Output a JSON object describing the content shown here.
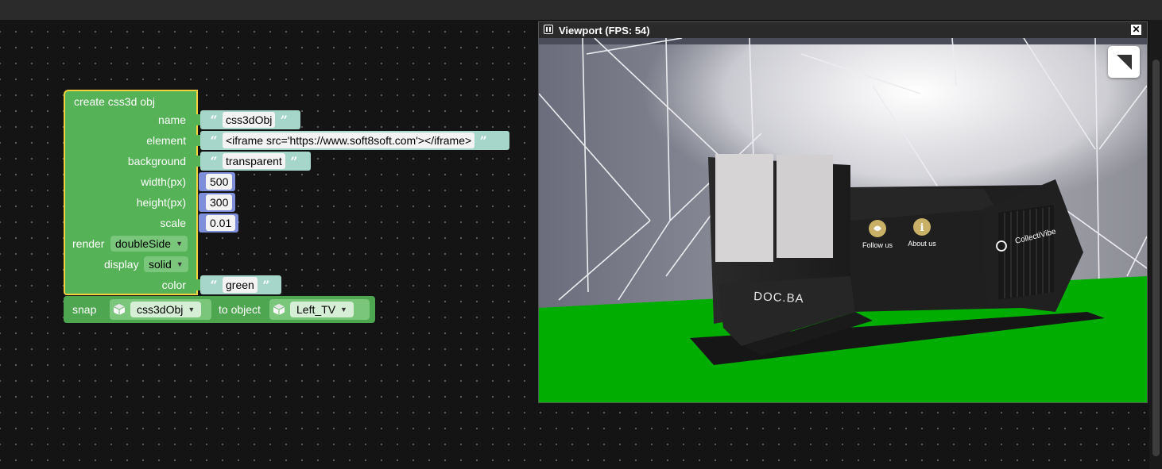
{
  "block": {
    "title": "create css3d obj",
    "fields": {
      "name_label": "name",
      "name_value": "css3dObj",
      "element_label": "element",
      "element_value": "<iframe src='https://www.soft8soft.com'></iframe>",
      "background_label": "background",
      "background_value": "transparent",
      "width_label": "width(px)",
      "width_value": "500",
      "height_label": "height(px)",
      "height_value": "300",
      "scale_label": "scale",
      "scale_value": "0.01",
      "render_label": "render",
      "render_value": "doubleSide",
      "display_label": "display",
      "display_value": "solid",
      "color_label": "color",
      "color_value": "green"
    },
    "colors": {
      "block": "#55b256",
      "selected_outline": "#f4d03f",
      "text": "#a5d6c9",
      "number": "#7f8ed8"
    }
  },
  "snap_block": {
    "label": "snap",
    "object_value": "css3dObj",
    "to_label": "to object",
    "target_value": "Left_TV"
  },
  "viewport": {
    "title": "Viewport (FPS: 54)",
    "booth": {
      "logo_text": "DOC.BA",
      "follow_label": "Follow us",
      "about_label": "About us",
      "brand_label": "CollectiVibe"
    }
  }
}
